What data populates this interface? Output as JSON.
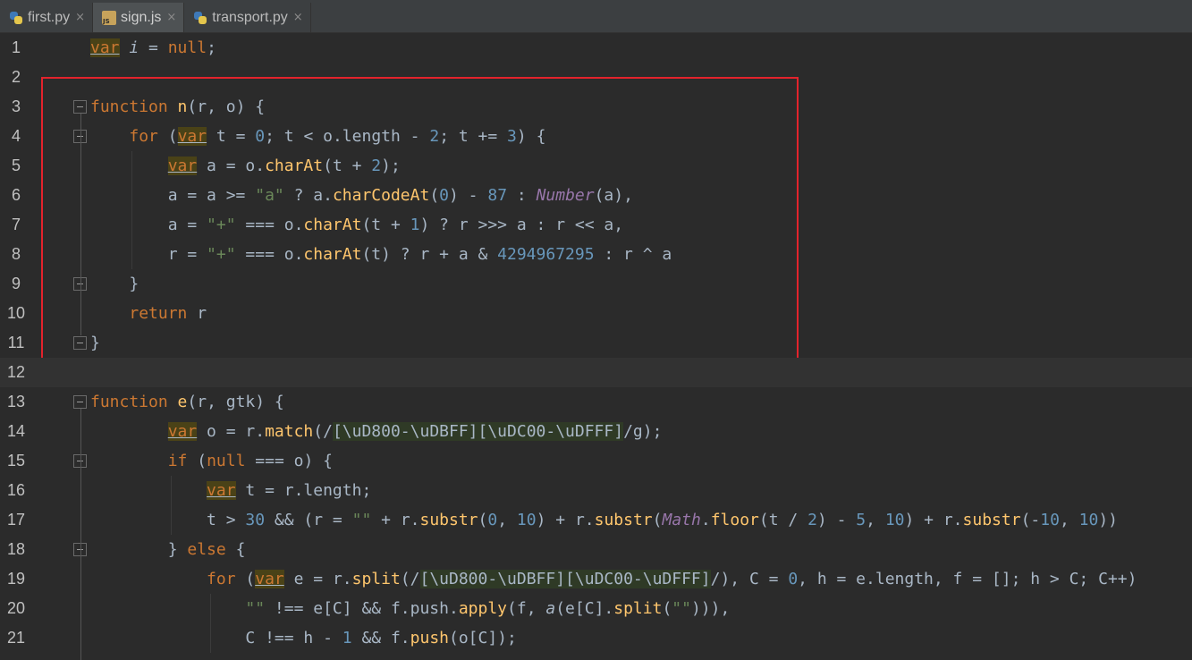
{
  "tabs": [
    {
      "label": "first.py",
      "icon": "python-file-icon",
      "active": false
    },
    {
      "label": "sign.js",
      "icon": "js-file-icon",
      "active": true
    },
    {
      "label": "transport.py",
      "icon": "python-file-icon",
      "active": false
    }
  ],
  "close_glyph": "×",
  "line_numbers": [
    "1",
    "2",
    "3",
    "4",
    "5",
    "6",
    "7",
    "8",
    "9",
    "10",
    "11",
    "12",
    "13",
    "14",
    "15",
    "16",
    "17",
    "18",
    "19",
    "20",
    "21"
  ],
  "code_lines": [
    "var i = null;",
    "",
    "function n(r, o) {",
    "    for (var t = 0; t < o.length - 2; t += 3) {",
    "        var a = o.charAt(t + 2);",
    "        a = a >= \"a\" ? a.charCodeAt(0) - 87 : Number(a),",
    "        a = \"+\" === o.charAt(t + 1) ? r >>> a : r << a,",
    "        r = \"+\" === o.charAt(t) ? r + a & 4294967295 : r ^ a",
    "    }",
    "    return r",
    "}",
    "",
    "function e(r, gtk) {",
    "        var o = r.match(/[\\uD800-\\uDBFF][\\uDC00-\\uDFFF]/g);",
    "        if (null === o) {",
    "            var t = r.length;",
    "            t > 30 && (r = \"\" + r.substr(0, 10) + r.substr(Math.floor(t / 2) - 5, 10) + r.substr(-10, 10))",
    "        } else {",
    "            for (var e = r.split(/[\\uD800-\\uDBFF][\\uDC00-\\uDFFF]/), C = 0, h = e.length, f = []; h > C; C++)",
    "                \"\" !== e[C] && f.push.apply(f, a(e[C].split(\"\"))),",
    "                C !== h - 1 && f.push(o[C]);"
  ],
  "colors": {
    "background": "#2b2b2b",
    "highlight_box": "#e3232c",
    "keyword": "#cc7832",
    "number": "#6897bb",
    "string": "#6a8759"
  }
}
